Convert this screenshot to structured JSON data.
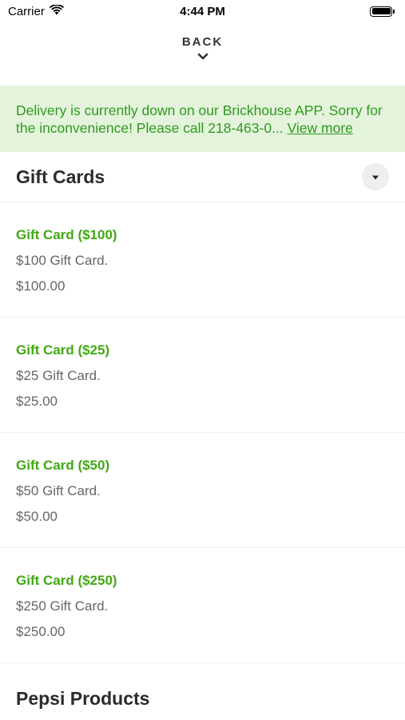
{
  "status_bar": {
    "carrier": "Carrier",
    "time": "4:44 PM"
  },
  "nav": {
    "back_label": "BACK"
  },
  "banner": {
    "message": "Delivery is currently down on our Brickhouse APP. Sorry for the inconvenience! Please call 218-463-0...",
    "link_text": "View more"
  },
  "section": {
    "title": "Gift Cards"
  },
  "items": [
    {
      "name": "Gift Card ($100)",
      "description": "$100 Gift Card.",
      "price": "$100.00"
    },
    {
      "name": "Gift Card ($25)",
      "description": "$25 Gift Card.",
      "price": "$25.00"
    },
    {
      "name": "Gift Card ($50)",
      "description": "$50 Gift Card.",
      "price": "$50.00"
    },
    {
      "name": "Gift Card ($250)",
      "description": "$250 Gift Card.",
      "price": "$250.00"
    }
  ],
  "next_section": {
    "title": "Pepsi Products"
  },
  "colors": {
    "accent_green": "#41a814",
    "banner_bg": "#e4f4dc",
    "banner_text": "#2f9a1e"
  },
  "icons": {
    "wifi": "wifi-icon",
    "battery": "battery-icon",
    "back_chevron": "chevron-down-icon",
    "dropdown": "caret-down-icon"
  }
}
